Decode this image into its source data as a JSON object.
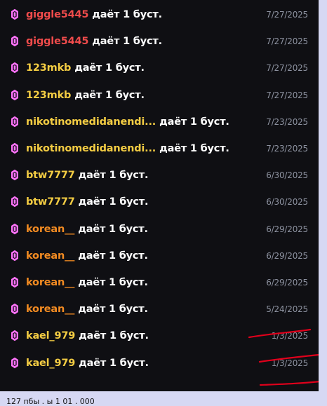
{
  "boost_log": {
    "action_text": "даёт 1 буст.",
    "entries": [
      {
        "user": "giggle5445",
        "date": "7/27/2025",
        "user_color": "#ef4b4b"
      },
      {
        "user": "giggle5445",
        "date": "7/27/2025",
        "user_color": "#ef4b4b"
      },
      {
        "user": "123mkb",
        "date": "7/27/2025",
        "user_color": "#f3cc43"
      },
      {
        "user": "123mkb",
        "date": "7/27/2025",
        "user_color": "#f3cc43"
      },
      {
        "user": "nikotinomedidanendi...",
        "date": "7/23/2025",
        "user_color": "#f3cc43"
      },
      {
        "user": "nikotinomedidanendi...",
        "date": "7/23/2025",
        "user_color": "#f3cc43"
      },
      {
        "user": "btw7777",
        "date": "6/30/2025",
        "user_color": "#f3cc43"
      },
      {
        "user": "btw7777",
        "date": "6/30/2025",
        "user_color": "#f3cc43"
      },
      {
        "user": "korean__",
        "date": "6/29/2025",
        "user_color": "#f28b22"
      },
      {
        "user": "korean__",
        "date": "6/29/2025",
        "user_color": "#f28b22"
      },
      {
        "user": "korean__",
        "date": "6/29/2025",
        "user_color": "#f28b22"
      },
      {
        "user": "korean__",
        "date": "5/24/2025",
        "user_color": "#f28b22"
      },
      {
        "user": "kael_979",
        "date": "1/3/2025",
        "user_color": "#f3cc43"
      },
      {
        "user": "kael_979",
        "date": "1/3/2025",
        "user_color": "#f3cc43"
      }
    ]
  },
  "colors": {
    "background": "#0f0f13",
    "boost_icon": "#ff73fa",
    "date_text": "#8d92a0",
    "annotation": "#e0001b",
    "footer_background": "#d6d8f3"
  },
  "footer": {
    "text": "127 пбы . ы 1 01 . 000"
  }
}
